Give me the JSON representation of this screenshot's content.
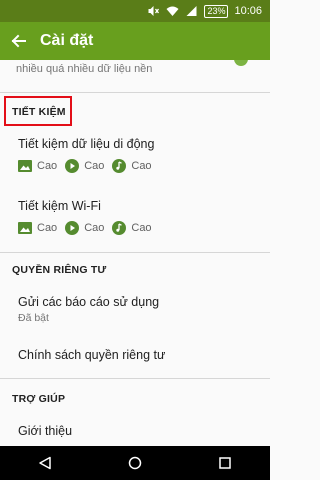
{
  "status_bar": {
    "battery": "23%",
    "time": "10:06"
  },
  "toolbar": {
    "title": "Cài đặt"
  },
  "cut_off_text": "nhiều quá nhiều dữ liệu nền",
  "sections": {
    "saving": {
      "header": "TIẾT KIỆM",
      "mobile_data": {
        "title": "Tiết kiệm dữ liệu di động",
        "image_quality": "Cao",
        "video_quality": "Cao",
        "audio_quality": "Cao"
      },
      "wifi": {
        "title": "Tiết kiệm Wi-Fi",
        "image_quality": "Cao",
        "video_quality": "Cao",
        "audio_quality": "Cao"
      }
    },
    "privacy": {
      "header": "QUYỀN RIÊNG TƯ",
      "usage_reports": {
        "title": "Gửi các báo cáo sử dụng",
        "status": "Đã bật"
      },
      "privacy_policy": {
        "title": "Chính sách quyền riêng tư"
      }
    },
    "help": {
      "header": "TRỢ GIÚP",
      "about": {
        "title": "Giới thiệu"
      }
    }
  },
  "colors": {
    "status_bar": "#5a7d18",
    "toolbar": "#689f1e",
    "icon_green": "#558b2f",
    "highlight": "#e30e18"
  },
  "icons": {
    "image": "image-icon",
    "video": "play-circle-icon",
    "audio": "music-note-icon"
  }
}
